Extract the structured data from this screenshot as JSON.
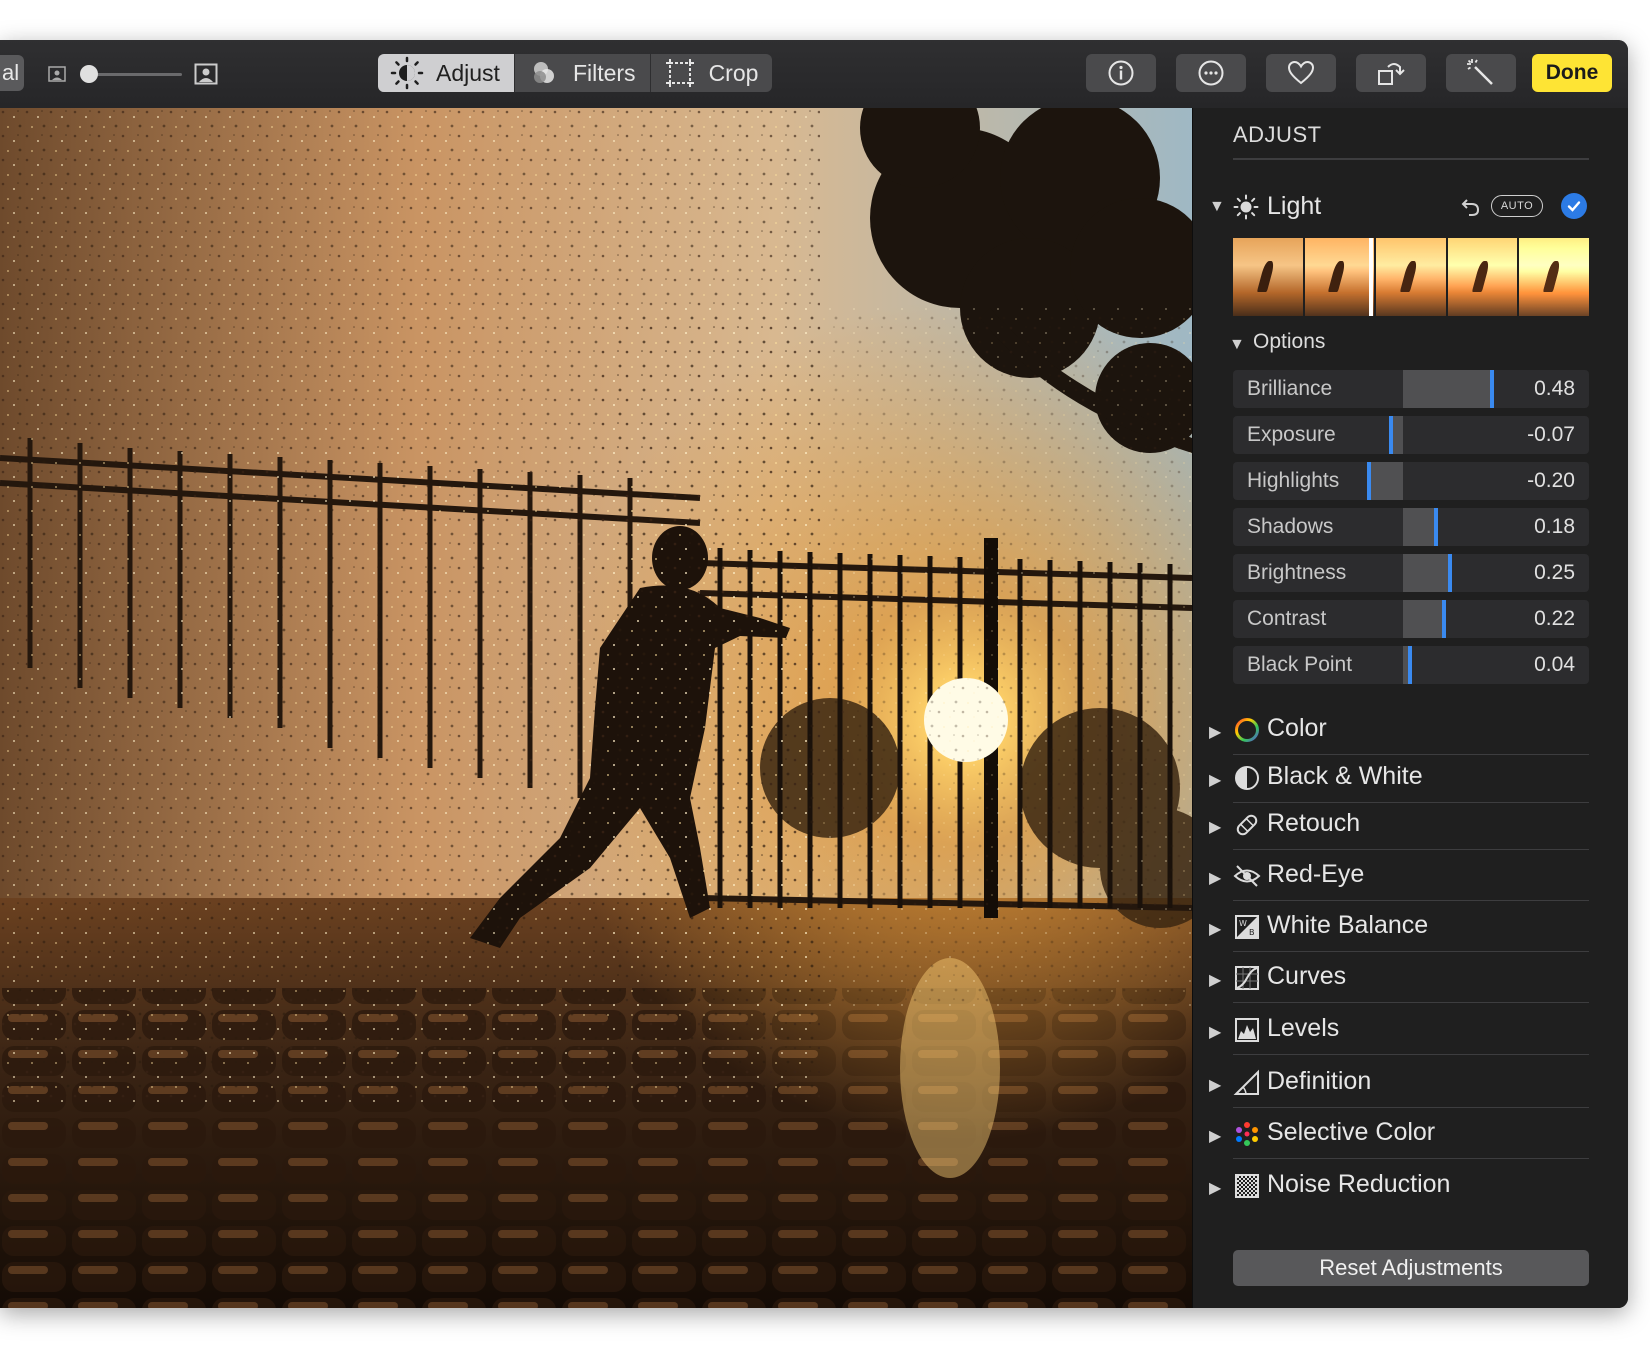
{
  "toolbar": {
    "left_button_label": "al",
    "tabs": [
      {
        "label": "Adjust",
        "icon": "adjust-icon",
        "active": true
      },
      {
        "label": "Filters",
        "icon": "filters-icon",
        "active": false
      },
      {
        "label": "Crop",
        "icon": "crop-icon",
        "active": false
      }
    ],
    "tools": [
      "info-icon",
      "more-icon",
      "heart-icon",
      "rotate-icon",
      "magic-wand-icon"
    ],
    "done_label": "Done",
    "done_color": "#fee434"
  },
  "sidebar": {
    "title": "ADJUST",
    "light": {
      "label": "Light",
      "auto_label": "AUTO",
      "options_label": "Options",
      "sliders": [
        {
          "label": "Brilliance",
          "value": "0.48",
          "num": 0.48
        },
        {
          "label": "Exposure",
          "value": "-0.07",
          "num": -0.07
        },
        {
          "label": "Highlights",
          "value": "-0.20",
          "num": -0.2
        },
        {
          "label": "Shadows",
          "value": "0.18",
          "num": 0.18
        },
        {
          "label": "Brightness",
          "value": "0.25",
          "num": 0.25
        },
        {
          "label": "Contrast",
          "value": "0.22",
          "num": 0.22
        },
        {
          "label": "Black Point",
          "value": "0.04",
          "num": 0.04
        }
      ]
    },
    "sections": [
      {
        "label": "Color",
        "icon": "color-ring-icon"
      },
      {
        "label": "Black & White",
        "icon": "half-circle-icon"
      },
      {
        "label": "Retouch",
        "icon": "bandage-icon"
      },
      {
        "label": "Red-Eye",
        "icon": "eye-slash-icon"
      },
      {
        "label": "White Balance",
        "icon": "white-balance-icon"
      },
      {
        "label": "Curves",
        "icon": "curves-icon"
      },
      {
        "label": "Levels",
        "icon": "levels-icon"
      },
      {
        "label": "Definition",
        "icon": "definition-icon"
      },
      {
        "label": "Selective Color",
        "icon": "selective-color-icon"
      },
      {
        "label": "Noise Reduction",
        "icon": "noise-reduction-icon"
      }
    ],
    "reset_label": "Reset Adjustments",
    "accent_color": "#3a8af0"
  }
}
